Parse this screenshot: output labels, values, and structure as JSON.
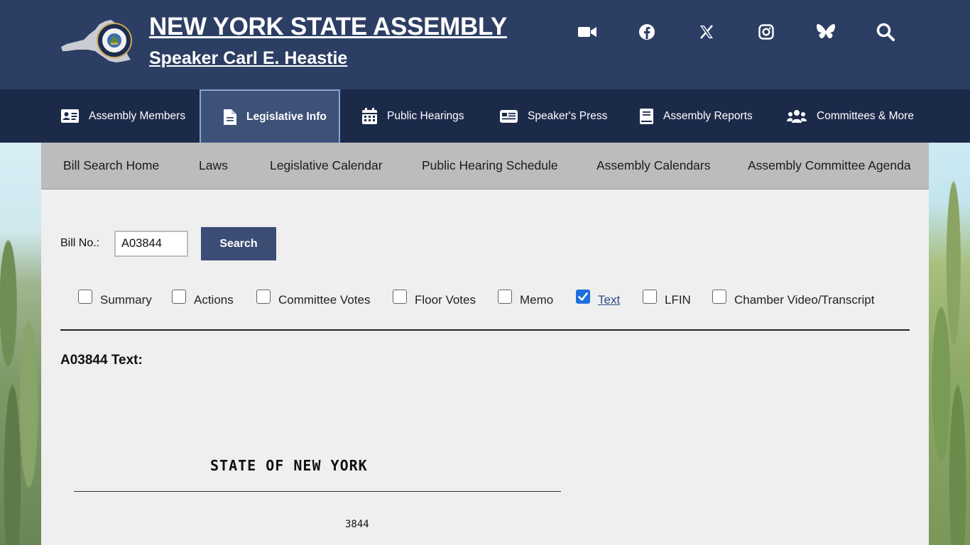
{
  "header": {
    "title": "NEW YORK STATE ASSEMBLY",
    "subtitle": "Speaker Carl E. Heastie",
    "social": [
      {
        "name": "video-icon"
      },
      {
        "name": "facebook-icon"
      },
      {
        "name": "x-icon"
      },
      {
        "name": "instagram-icon"
      },
      {
        "name": "bluesky-icon"
      },
      {
        "name": "search-icon"
      }
    ]
  },
  "nav": {
    "items": [
      {
        "label": "Assembly Members",
        "icon": "id-card-icon"
      },
      {
        "label": "Legislative Info",
        "icon": "document-icon",
        "active": true
      },
      {
        "label": "Public Hearings",
        "icon": "calendar-icon"
      },
      {
        "label": "Speaker's Press",
        "icon": "newspaper-icon"
      },
      {
        "label": "Assembly Reports",
        "icon": "book-icon"
      },
      {
        "label": "Committees & More",
        "icon": "users-icon"
      }
    ]
  },
  "subnav": {
    "items": [
      {
        "label": "Bill Search Home"
      },
      {
        "label": "Laws"
      },
      {
        "label": "Legislative Calendar"
      },
      {
        "label": "Public Hearing Schedule"
      },
      {
        "label": "Assembly Calendars"
      },
      {
        "label": "Assembly Committee Agenda"
      }
    ]
  },
  "search": {
    "label": "Bill No.:",
    "value": "A03844",
    "button": "Search"
  },
  "options": [
    {
      "label": "Summary",
      "checked": false
    },
    {
      "label": "Actions",
      "checked": false
    },
    {
      "label": "Committee Votes",
      "checked": false
    },
    {
      "label": "Floor Votes",
      "checked": false
    },
    {
      "label": "Memo",
      "checked": false
    },
    {
      "label": "Text",
      "checked": true
    },
    {
      "label": "LFIN",
      "checked": false
    },
    {
      "label": "Chamber Video/Transcript",
      "checked": false
    }
  ],
  "content": {
    "heading": "A03844 Text:",
    "state_line": "STATE OF NEW YORK",
    "bill_number": "3844"
  },
  "colors": {
    "header_bg": "#2c3e63",
    "nav_bg": "#1c2a4a",
    "active_nav_bg": "#3e5178",
    "button_bg": "#3b4c75",
    "checkbox_checked": "#1e6fe0"
  }
}
